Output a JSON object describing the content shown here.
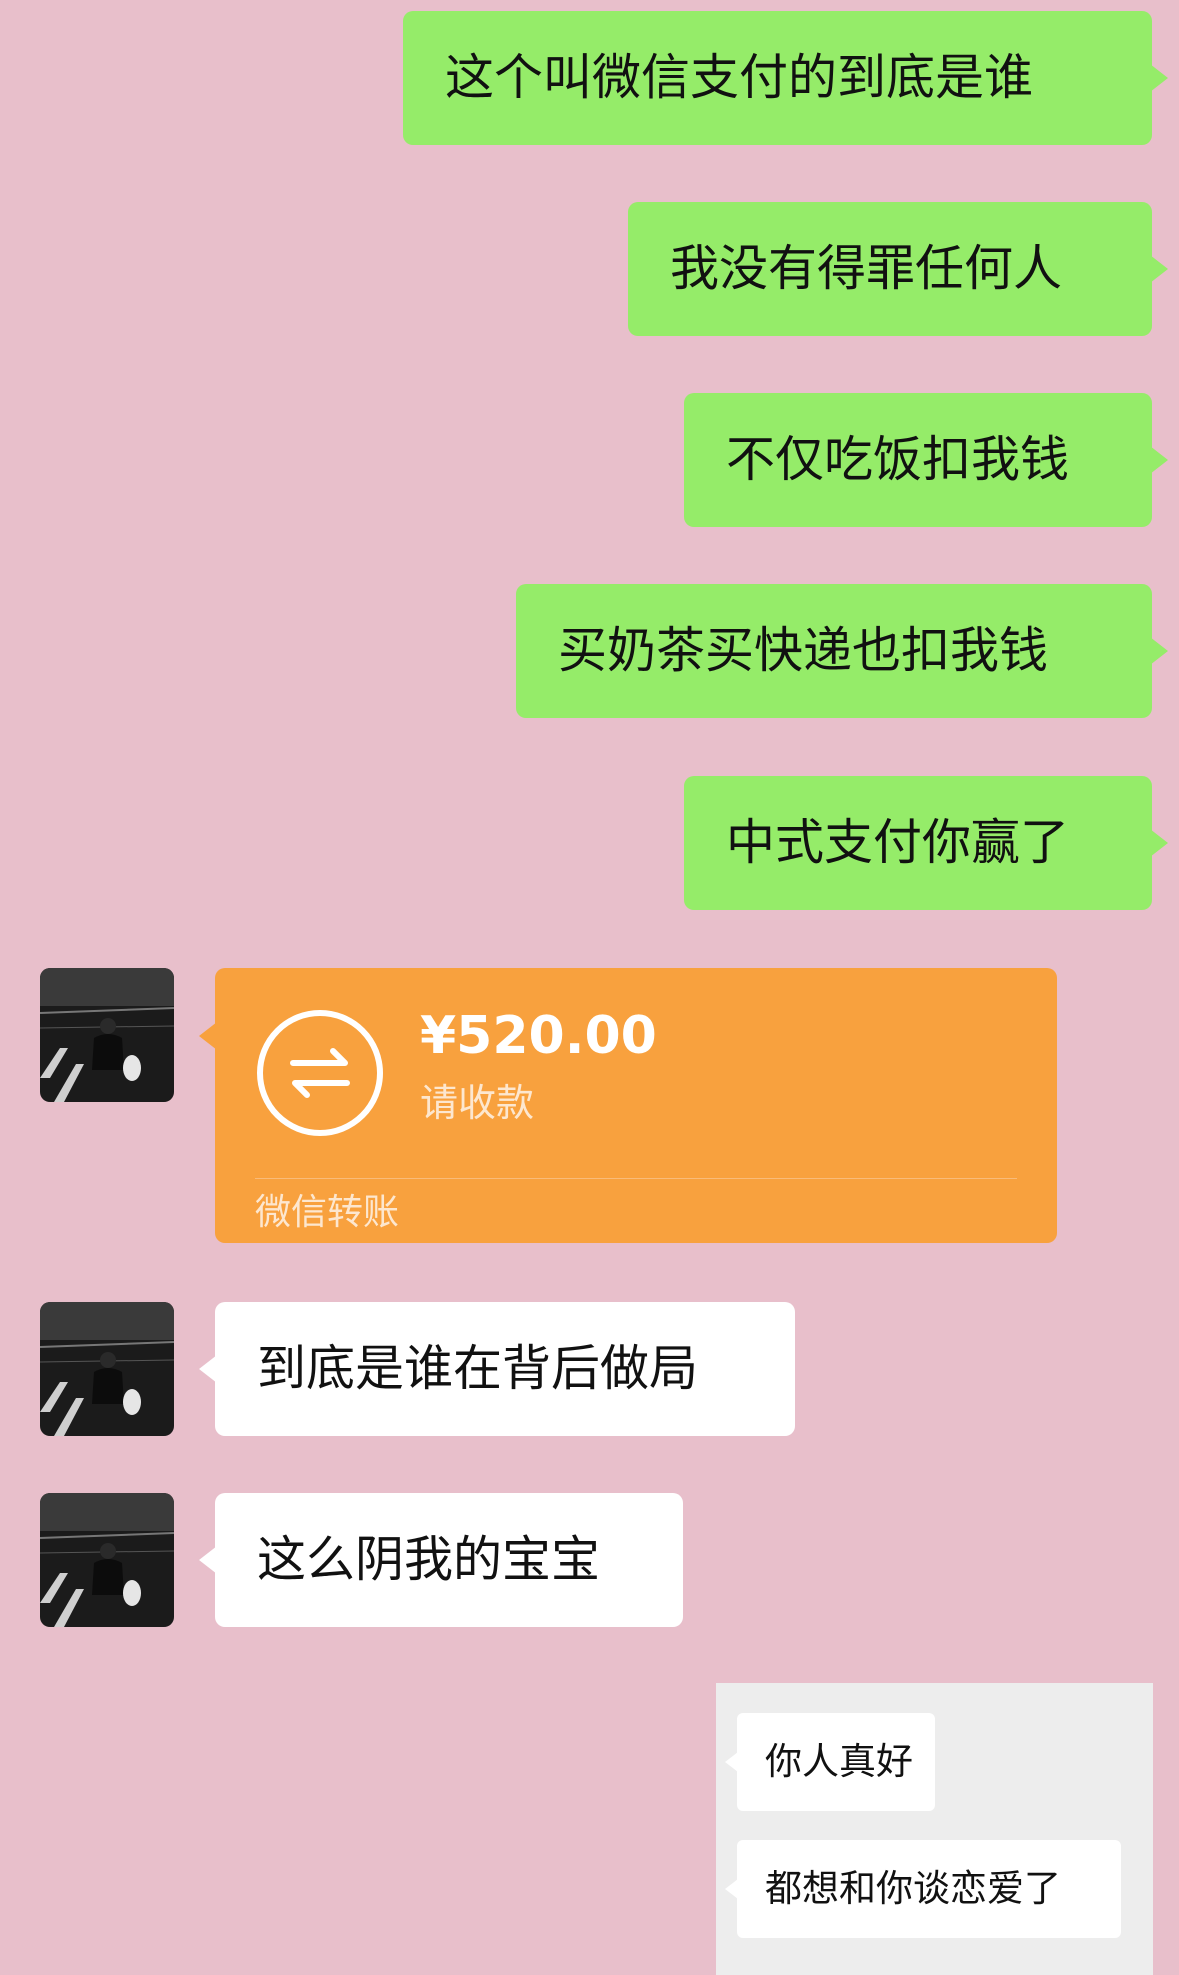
{
  "colors": {
    "background": "#e8bfcb",
    "outgoing_bubble": "#95ec69",
    "incoming_bubble": "#ffffff",
    "transfer_card": "#f8a13e"
  },
  "outgoing_messages": [
    {
      "text": "这个叫微信支付的到底是谁"
    },
    {
      "text": "我没有得罪任何人"
    },
    {
      "text": "不仅吃饭扣我钱"
    },
    {
      "text": "买奶茶买快递也扣我钱"
    },
    {
      "text": "中式支付你赢了"
    }
  ],
  "transfer": {
    "icon": "transfer-arrows-icon",
    "amount": "¥520.00",
    "status": "请收款",
    "footer": "微信转账"
  },
  "incoming_messages": [
    {
      "text": "到底是谁在背后做局"
    },
    {
      "text": "这么阴我的宝宝"
    }
  ],
  "inset_reply": [
    {
      "text": "你人真好"
    },
    {
      "text": "都想和你谈恋爱了"
    }
  ]
}
